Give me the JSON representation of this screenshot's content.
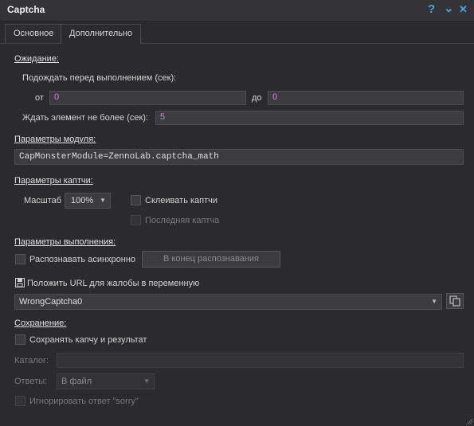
{
  "window": {
    "title": "Captcha",
    "help_glyph": "?",
    "pin_glyph": "⌄",
    "close_glyph": "✕"
  },
  "tabs": [
    {
      "label": "Основное",
      "active": false
    },
    {
      "label": "Дополнительно",
      "active": true
    }
  ],
  "waiting": {
    "section_label": "Ожидание:",
    "wait_before_label": "Подождать перед выполнением (сек):",
    "from_label": "от",
    "from_value": "0",
    "to_label": "до",
    "to_value": "0",
    "wait_element_label": "Ждать элемент не более (сек):",
    "wait_element_value": "5"
  },
  "module": {
    "section_label": "Параметры модуля:",
    "value": "CapMonsterModule=ZennoLab.captcha_math"
  },
  "captcha": {
    "section_label": "Параметры каптчи:",
    "scale_label": "Масштаб",
    "scale_value": "100%",
    "merge_label": "Склеивать каптчи",
    "merge_checked": false,
    "last_label": "Последняя каптча",
    "last_checked": false
  },
  "execution": {
    "section_label": "Параметры выполнения:",
    "async_label": "Распознавать асинхронно",
    "async_checked": false,
    "end_button_label": "В конец распознавания"
  },
  "complaint": {
    "label": "Положить URL для жалобы в переменную",
    "variable_value": "WrongCaptcha0"
  },
  "saving": {
    "section_label": "Сохранение:",
    "save_label": "Сохранять капчу и результат",
    "save_checked": false,
    "catalog_label": "Каталог:",
    "catalog_value": "",
    "answers_label": "Ответы:",
    "answers_value": "В файл",
    "ignore_label": "Игнорировать ответ \"sorry\"",
    "ignore_checked": false
  },
  "colors": {
    "accent": "#4da3d8",
    "number": "#c98bd7",
    "background": "#2b2b2d"
  }
}
